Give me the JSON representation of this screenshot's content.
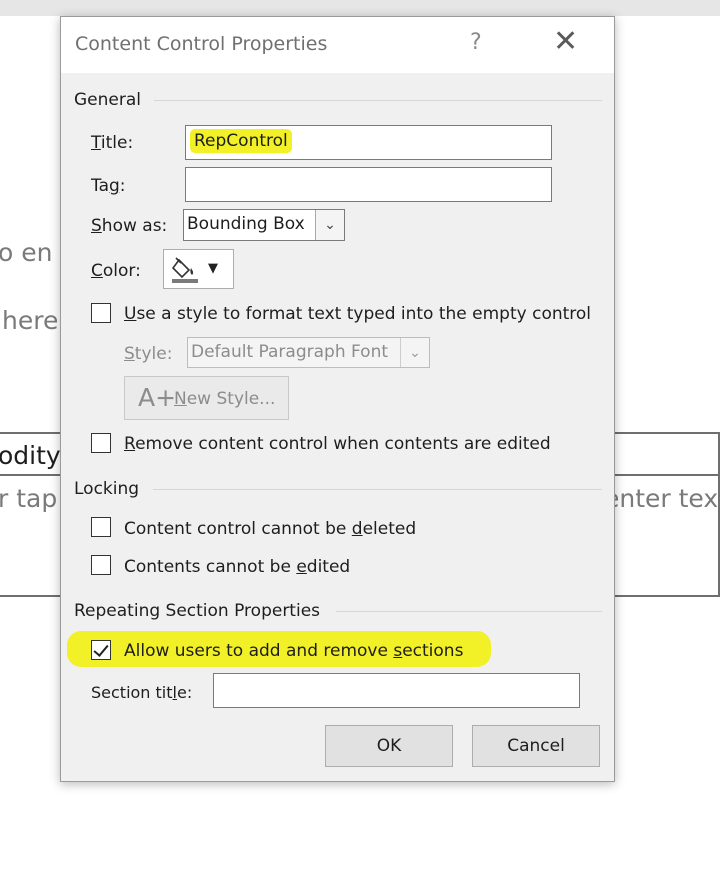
{
  "background": {
    "fragments": [
      {
        "name": "bg-text-enter",
        "text": "o en"
      },
      {
        "name": "bg-text-here",
        "text": "here"
      },
      {
        "name": "bg-text-commodity",
        "text": "odity"
      },
      {
        "name": "bg-text-tap",
        "text": "r tap"
      },
      {
        "name": "bg-text-enter-text",
        "text": "enter tex"
      }
    ]
  },
  "dialog": {
    "title": "Content Control Properties",
    "help_glyph": "?",
    "close_glyph": "✕",
    "general": {
      "heading": "General",
      "title_label": {
        "key": "T",
        "rest": "itle:"
      },
      "title_value": "RepControl",
      "tag_label": {
        "pre": "Ta",
        "key": "g",
        "rest": ":"
      },
      "tag_value": "",
      "show_as_label": {
        "key": "S",
        "rest": "how as:"
      },
      "show_as_value": "Bounding Box",
      "color_label": {
        "key": "C",
        "rest": "olor:"
      },
      "use_style_label": {
        "key": "U",
        "rest": "se a style to format text typed into the empty control"
      },
      "style_label": {
        "key": "S",
        "rest": "tyle:"
      },
      "style_value": "Default Paragraph Font",
      "new_style_icon": "A+",
      "new_style_label": {
        "key": "N",
        "rest": "ew Style..."
      },
      "remove_label": {
        "key": "R",
        "rest": "emove content control when contents are edited"
      }
    },
    "locking": {
      "heading": "Locking",
      "cannot_delete_label": {
        "pre": "Content control cannot be ",
        "key": "d",
        "rest": "eleted"
      },
      "cannot_edit_label": {
        "pre": "Contents cannot be ",
        "key": "e",
        "rest": "dited"
      }
    },
    "repeating": {
      "heading": "Repeating Section Properties",
      "allow_label": {
        "pre": "Allow users to add and remove ",
        "key": "s",
        "rest": "ections"
      },
      "allow_checked": true,
      "section_title_label": {
        "pre": "Section tit",
        "key": "l",
        "rest": "e:"
      },
      "section_title_value": ""
    },
    "buttons": {
      "ok": "OK",
      "cancel": "Cancel"
    },
    "colors": {
      "highlight": "#f2f026",
      "dialog_bg": "#f0f0f0"
    }
  }
}
